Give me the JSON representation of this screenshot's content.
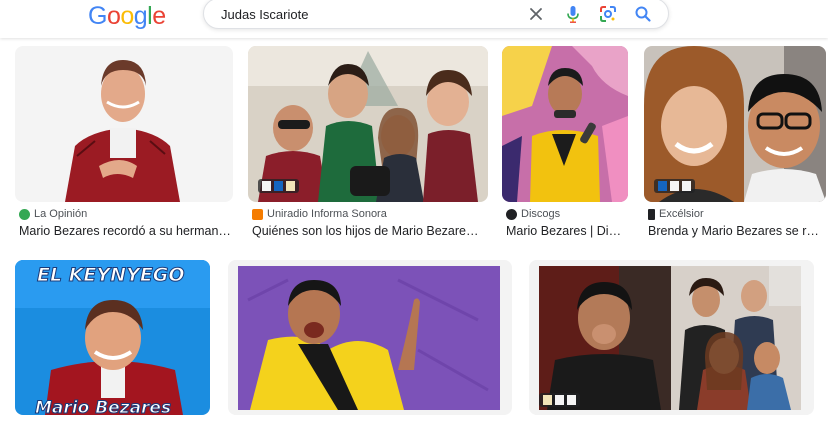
{
  "header": {
    "logo_letters": [
      "G",
      "o",
      "o",
      "g",
      "l",
      "e"
    ],
    "logo_colors": [
      "#4285F4",
      "#EA4335",
      "#FBBC05",
      "#4285F4",
      "#34A853",
      "#EA4335"
    ],
    "search_value": "Judas Iscariote",
    "icons": [
      "close-icon",
      "microphone-icon",
      "google-lens-icon",
      "search-icon"
    ]
  },
  "results": [
    {
      "source": "La Opinión",
      "title": "Mario Bezares recordó a su herman…",
      "favicon_color": "#34A853"
    },
    {
      "source": "Uniradio Informa Sonora",
      "title": "Quiénes son los hijos de Mario Bezare…",
      "favicon_color": "#F57C00"
    },
    {
      "source": "Discogs",
      "title": "Mario Bezares | Di…",
      "favicon_color": "#202124"
    },
    {
      "source": "Excélsior",
      "title": "Brenda y Mario Bezares se r…",
      "favicon_color": "#202124"
    },
    {
      "overlay_text": "EL KEYNYEGO",
      "bottom_text": "Mario Bezares"
    },
    {},
    {}
  ]
}
